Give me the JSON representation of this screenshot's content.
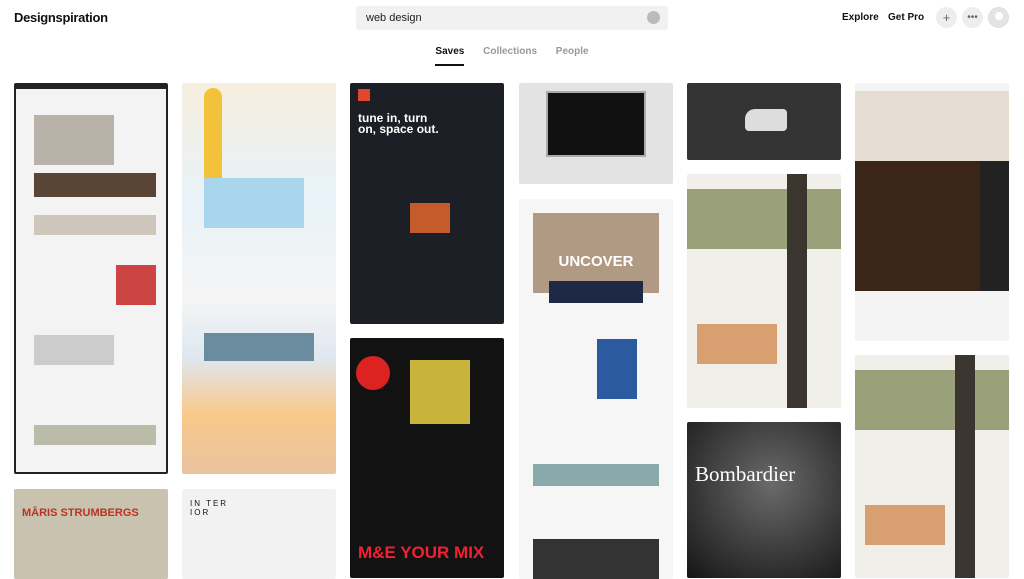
{
  "header": {
    "logo": "Designspiration",
    "search_value": "web design",
    "explore": "Explore",
    "get_pro": "Get Pro",
    "add_icon": "plus-icon",
    "more_icon": "ellipsis-icon",
    "color_icon": "palette-icon"
  },
  "tabs": [
    {
      "label": "Saves",
      "active": true
    },
    {
      "label": "Collections"
    },
    {
      "label": "People"
    }
  ],
  "cards": {
    "c3a_text": "tune in, turn on, space out.",
    "c4b_text": "UNCOVER",
    "c5c_text": "Bombardier",
    "c1b_text": "MĀRIS STRUMBERGS",
    "c2b_text": "IN TER IOR",
    "c3b_text": "M&E YOUR MIX"
  }
}
